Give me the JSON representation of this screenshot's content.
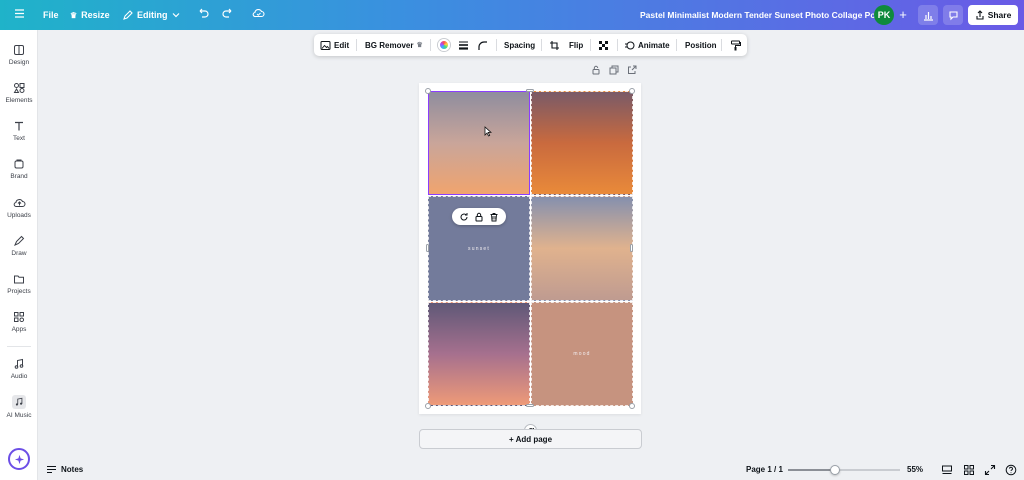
{
  "topbar": {
    "file_label": "File",
    "resize_label": "Resize",
    "editing_label": "Editing",
    "doc_title": "Pastel Minimalist Modern Tender Sunset Photo Collage Port...",
    "avatar_initials": "PK",
    "share_label": "Share",
    "gradient": [
      "#1fb3c9",
      "#6a5ae6"
    ]
  },
  "sidebar": {
    "items": [
      {
        "label": "Design",
        "icon": "design-icon"
      },
      {
        "label": "Elements",
        "icon": "elements-icon"
      },
      {
        "label": "Text",
        "icon": "text-icon"
      },
      {
        "label": "Brand",
        "icon": "brand-icon"
      },
      {
        "label": "Uploads",
        "icon": "uploads-icon"
      },
      {
        "label": "Draw",
        "icon": "draw-icon"
      },
      {
        "label": "Projects",
        "icon": "projects-icon"
      },
      {
        "label": "Apps",
        "icon": "apps-icon"
      },
      {
        "label": "Audio",
        "icon": "audio-icon"
      },
      {
        "label": "AI Music",
        "icon": "ai-music-icon"
      }
    ]
  },
  "toolbar": {
    "edit_label": "Edit",
    "bg_remover_label": "BG Remover",
    "spacing_label": "Spacing",
    "flip_label": "Flip",
    "animate_label": "Animate",
    "position_label": "Position"
  },
  "canvas": {
    "tiles": [
      {
        "name": "sunset-photo-1",
        "colors": [
          "#8f8d9e",
          "#c9a59a",
          "#f0a46e"
        ]
      },
      {
        "name": "sunset-photo-2",
        "colors": [
          "#7a5a67",
          "#c96a3e",
          "#e98a3a"
        ]
      },
      {
        "name": "text-tile-sunset",
        "text": "sunset",
        "colors": [
          "#737b9b",
          "#737b9b"
        ]
      },
      {
        "name": "sunset-photo-3",
        "colors": [
          "#8590ae",
          "#e0b28e",
          "#bf9b90"
        ]
      },
      {
        "name": "sunset-photo-4",
        "colors": [
          "#5f5877",
          "#a6708e",
          "#ee9a78"
        ]
      },
      {
        "name": "text-tile-mood",
        "text": "mood",
        "colors": [
          "#c6937f",
          "#c6937f"
        ]
      }
    ],
    "add_page_label": "+ Add page",
    "selection_color": "#8b3dff"
  },
  "bottombar": {
    "notes_label": "Notes",
    "page_indicator": "Page 1 / 1",
    "zoom_label": "55%",
    "zoom_fraction": 0.42
  }
}
